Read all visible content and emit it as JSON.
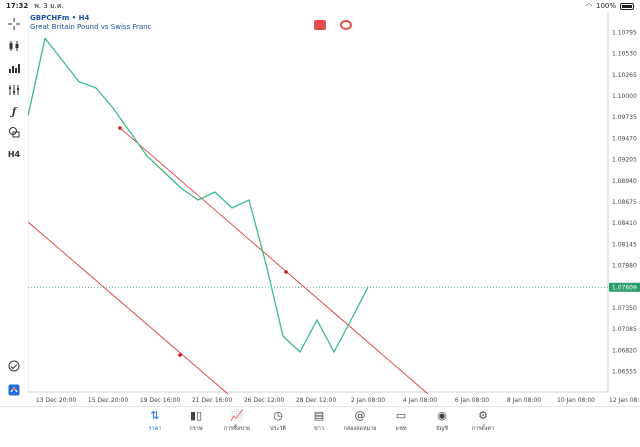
{
  "status_bar": {
    "time": "17:32",
    "date": "พ. 3 ม.ค.",
    "wifi_icon": "wifi-icon",
    "battery": "100%"
  },
  "symbol": {
    "name": "GBPCHFm • H4",
    "description": "Great Britain Pound vs Swiss Franc"
  },
  "toolbar": {
    "tools": [
      "crosshair-icon",
      "candlestick-icon",
      "bar-chart-icon",
      "indicators-icon",
      "function-icon",
      "objects-icon"
    ],
    "timeframe": "H4",
    "bottom": [
      "history-icon",
      "app-logo-icon"
    ]
  },
  "price_axis": {
    "labels": [
      "1.10795",
      "1.10530",
      "1.10265",
      "1.10000",
      "1.09735",
      "1.09470",
      "1.09205",
      "1.08940",
      "1.08675",
      "1.08410",
      "1.08145",
      "1.07880",
      "1.07350",
      "1.07085",
      "1.06820",
      "1.06555"
    ],
    "current": "1.07609"
  },
  "time_axis": {
    "labels": [
      "13 Dec 20:00",
      "15 Dec 20:00",
      "19 Dec 16:00",
      "21 Dec 16:00",
      "26 Dec 12:00",
      "28 Dec 12:00",
      "2 Jan 08:00",
      "4 Jan 08:00",
      "6 Jan 08:00",
      "8 Jan 08:00",
      "10 Jan 08:00",
      "12 Jan 08:00"
    ]
  },
  "colors": {
    "line": "#3dbb85",
    "trendline": "#e03c3c",
    "accent": "#1a6fd8",
    "current_price_bg": "#2a9d6b"
  },
  "tabs": [
    {
      "icon": "quotes-icon",
      "label": "ราคา",
      "active": true
    },
    {
      "icon": "chart-icon",
      "label": "กราฟ",
      "active": false
    },
    {
      "icon": "trade-icon",
      "label": "การซื้อขาย",
      "active": false
    },
    {
      "icon": "history-icon",
      "label": "ประวัติ",
      "active": false
    },
    {
      "icon": "news-icon",
      "label": "ข่าว",
      "active": false
    },
    {
      "icon": "mailbox-icon",
      "label": "กล่องจดหมาย",
      "active": false
    },
    {
      "icon": "chat-icon",
      "label": "แชท",
      "active": false
    },
    {
      "icon": "accounts-icon",
      "label": "บัญชี",
      "active": false
    },
    {
      "icon": "settings-icon",
      "label": "การตั้งค่า",
      "active": false
    }
  ],
  "chart_data": {
    "type": "line",
    "title": "",
    "xlabel": "",
    "ylabel": "",
    "x": [
      "13 Dec 20:00",
      "14 Dec 08:00",
      "14 Dec 20:00",
      "15 Dec 08:00",
      "15 Dec 20:00",
      "16 Dec 08:00",
      "18 Dec 08:00",
      "19 Dec 08:00",
      "19 Dec 16:00",
      "20 Dec 08:00",
      "21 Dec 08:00",
      "21 Dec 16:00",
      "22 Dec 08:00",
      "26 Dec 08:00",
      "26 Dec 12:00",
      "27 Dec 08:00",
      "28 Dec 08:00",
      "28 Dec 12:00",
      "29 Dec 08:00",
      "2 Jan 08:00",
      "3 Jan 08:00"
    ],
    "series": [
      {
        "name": "",
        "values": [
          1.0975,
          1.1072,
          1.1045,
          1.1018,
          1.101,
          1.0985,
          1.0955,
          1.0925,
          1.0905,
          1.0885,
          1.087,
          1.088,
          1.086,
          1.087,
          1.079,
          1.07,
          1.068,
          1.072,
          1.068,
          1.072,
          1.0761
        ]
      }
    ],
    "ylim": [
      1.064,
      1.1095
    ],
    "grid": false,
    "legend": "none"
  }
}
